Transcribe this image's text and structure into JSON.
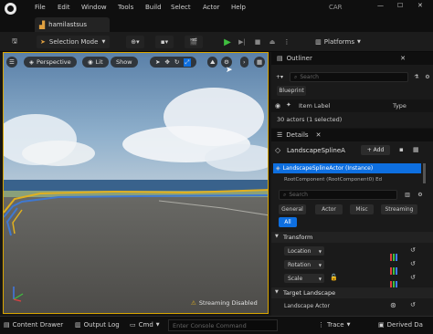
{
  "menu": [
    "File",
    "Edit",
    "Window",
    "Tools",
    "Build",
    "Select",
    "Actor",
    "Help"
  ],
  "project_badge": "CAR",
  "level_tab": "hamilastsus",
  "toolbar": {
    "selection_mode": "Selection Mode",
    "platforms": "Platforms"
  },
  "viewport": {
    "perspective": "Perspective",
    "lit": "Lit",
    "show": "Show",
    "streaming_status": "Streaming Disabled"
  },
  "outliner": {
    "title": "Outliner",
    "search_placeholder": "Search",
    "blueprint_btn": "Blueprint",
    "col_item_label": "Item Label",
    "col_type": "Type",
    "summary": "30 actors (1 selected)"
  },
  "details": {
    "title": "Details",
    "actor_name": "LandscapeSplineA",
    "add_btn": "+ Add",
    "selected_component": "LandscapeSplineActor (Instance)",
    "child_component": "RootComponent (RootComponent0) Ed",
    "search_placeholder": "Search",
    "tabs": [
      "General",
      "Actor",
      "Misc",
      "Streaming",
      "All"
    ],
    "sections": {
      "transform": "Transform",
      "location": "Location",
      "rotation": "Rotation",
      "scale": "Scale",
      "target_landscape": "Target Landscape",
      "landscape_actor": "Landscape Actor"
    }
  },
  "statusbar": {
    "content_drawer": "Content Drawer",
    "output_log": "Output Log",
    "cmd": "Cmd",
    "console_placeholder": "Enter Console Command",
    "trace": "Trace",
    "derived_data": "Derived Da"
  },
  "colors": {
    "accent_blue": "#0e6fe0",
    "play_green": "#3fbf3f",
    "viewport_border": "#d9a500",
    "x_red": "#e04040",
    "y_green": "#3fbf3f",
    "z_blue": "#3f7fff"
  }
}
